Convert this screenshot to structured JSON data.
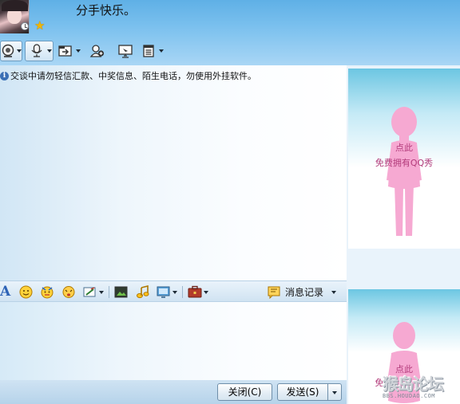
{
  "header": {
    "signature": "分手快乐。"
  },
  "toolbar_icons": [
    "video-icon",
    "microphone-icon",
    "file-transfer-icon",
    "add-contact-icon",
    "remote-assist-icon",
    "app-menu-icon"
  ],
  "chat": {
    "notice": "交谈中请勿轻信汇款、中奖信息、陌生电话，勿使用外挂软件。"
  },
  "qqshow_top": {
    "line1": "点此",
    "line2": "免费拥有QQ秀"
  },
  "qqshow_bottom": {
    "line1": "点此",
    "line2": "免"
  },
  "format_toolbar": {
    "font_label": "A",
    "history_label": "消息记录"
  },
  "buttons": {
    "close": "关闭(C)",
    "send": "发送(S)"
  },
  "watermark": {
    "main": "猴岛论坛",
    "sub": "BBS.HOUDAO.COM"
  },
  "colors": {
    "header_blue": "#6fb9ea",
    "qqshow_pink": "#f6a9d2",
    "qqshow_text": "#b23a7a"
  }
}
